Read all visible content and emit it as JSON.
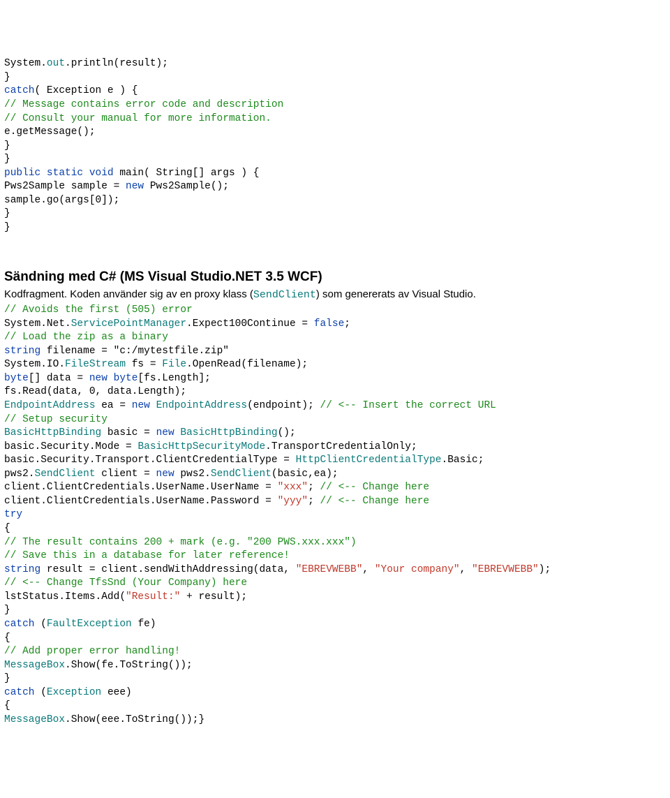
{
  "java": {
    "l1a": "System.",
    "l1b": "out",
    "l1c": ".println(result);",
    "l2": "}",
    "l3a": "catch",
    "l3b": "( Exception e ) {",
    "l4": "// Message contains error code and description",
    "l5": "// Consult your manual for more information.",
    "l6": "e.getMessage();",
    "l7": "}",
    "l8": "}",
    "l9a": "public static void ",
    "l9b": "main( String[] args ) {",
    "l10a": "Pws2Sample sample = ",
    "l10b": "new ",
    "l10c": "Pws2Sample();",
    "l11": "sample.go(args[0]);",
    "l12": "}",
    "l13": "}"
  },
  "heading": "Sändning med C# (MS Visual Studio.NET 3.5 WCF)",
  "desc_pre": "Kodfragment. Koden använder sig av en proxy klass (",
  "desc_mid": "SendClient",
  "desc_post": ") som genererats av Visual Studio.",
  "cs": {
    "c1": "// Avoids the first (505) error",
    "l1a": "System.Net.",
    "l1b": "ServicePointManager",
    "l1c": ".Expect100Continue = ",
    "l1d": "false",
    "l1e": ";",
    "c2": "// Load the zip as a binary",
    "l2a": "string",
    "l2b": " filename = ",
    "l2c": "\"c:/mytestfile.zip\"",
    "l3a": "System.IO.",
    "l3b": "FileStream",
    "l3c": " fs = ",
    "l3d": "File",
    "l3e": ".OpenRead(filename);",
    "l4a": "byte",
    "l4b": "[] data = ",
    "l4c": "new byte",
    "l4d": "[fs.Length];",
    "l5": "fs.Read(data, 0, data.Length);",
    "l6a": "EndpointAddress",
    "l6b": " ea = ",
    "l6c": "new ",
    "l6d": "EndpointAddress",
    "l6e": "(endpoint); ",
    "l6f": "// <-- Insert the correct URL",
    "c3": "// Setup security",
    "l7a": "BasicHttpBinding",
    "l7b": " basic = ",
    "l7c": "new ",
    "l7d": "BasicHttpBinding",
    "l7e": "();",
    "l8a": "basic.Security.Mode = ",
    "l8b": "BasicHttpSecurityMode",
    "l8c": ".TransportCredentialOnly;",
    "l9a": "basic.Security.Transport.ClientCredentialType = ",
    "l9b": "HttpClientCredentialType",
    "l9c": ".Basic;",
    "l10a": "pws2.",
    "l10b": "SendClient",
    "l10c": " client = ",
    "l10d": "new ",
    "l10e": "pws2.",
    "l10f": "SendClient",
    "l10g": "(basic,ea);",
    "l11a": "client.ClientCredentials.UserName.UserName = ",
    "l11b": "\"xxx\"",
    "l11c": "; ",
    "l11d": "// <-- Change here",
    "l12a": "client.ClientCredentials.UserName.Password = ",
    "l12b": "\"yyy\"",
    "l12c": "; ",
    "l12d": "// <-- Change here",
    "try": "try",
    "ob1": "{",
    "c4": "// The result contains 200 + mark (e.g. \"200 PWS.xxx.xxx\")",
    "c5": "// Save this in a database for later reference!",
    "l13a": "string",
    "l13b": " result = client.sendWithAddressing(data, ",
    "l13c": "\"EBREVWEBB\"",
    "l13d": ", ",
    "l13e": "\"Your company\"",
    "l13f": ", ",
    "l13g": "\"EBREVWEBB\"",
    "l13h": ");",
    "c6": "// <-- Change TfsSnd (Your Company) here",
    "l14a": "lstStatus.Items.Add(",
    "l14b": "\"Result:\"",
    "l14c": " + result);",
    "cb1": "}",
    "catch1a": "catch",
    "catch1b": " (",
    "catch1c": "FaultException",
    "catch1d": " fe)",
    "ob2": "{",
    "c7": "// Add proper error handling!",
    "l15a": "MessageBox",
    "l15b": ".Show(fe.ToString());",
    "cb2": "}",
    "catch2a": "catch",
    "catch2b": " (",
    "catch2c": "Exception",
    "catch2d": " eee)",
    "ob3": "{",
    "l16a": "MessageBox",
    "l16b": ".Show(eee.ToString());}"
  }
}
